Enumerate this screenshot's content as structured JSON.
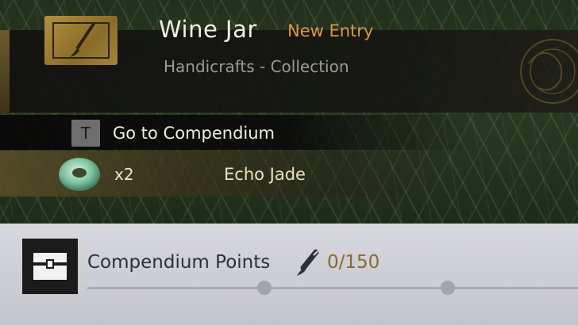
{
  "entry": {
    "title": "Wine Jar",
    "badge": "New Entry",
    "subtitle": "Handicrafts - Collection"
  },
  "compendium_action": {
    "key": "T",
    "label": "Go to Compendium"
  },
  "reward": {
    "quantity": "x2",
    "item_name": "Echo Jade"
  },
  "points": {
    "label": "Compendium Points",
    "value": "0/150",
    "current": 0,
    "max": 150
  },
  "icons": {
    "entry": "brush-frame-icon",
    "reward": "jade-ring-icon",
    "chest": "chest-icon",
    "points": "brush-icon"
  },
  "colors": {
    "badge": "#d99a3e",
    "points_value": "#8a6a2a",
    "gold_frame": "#b1903f"
  }
}
